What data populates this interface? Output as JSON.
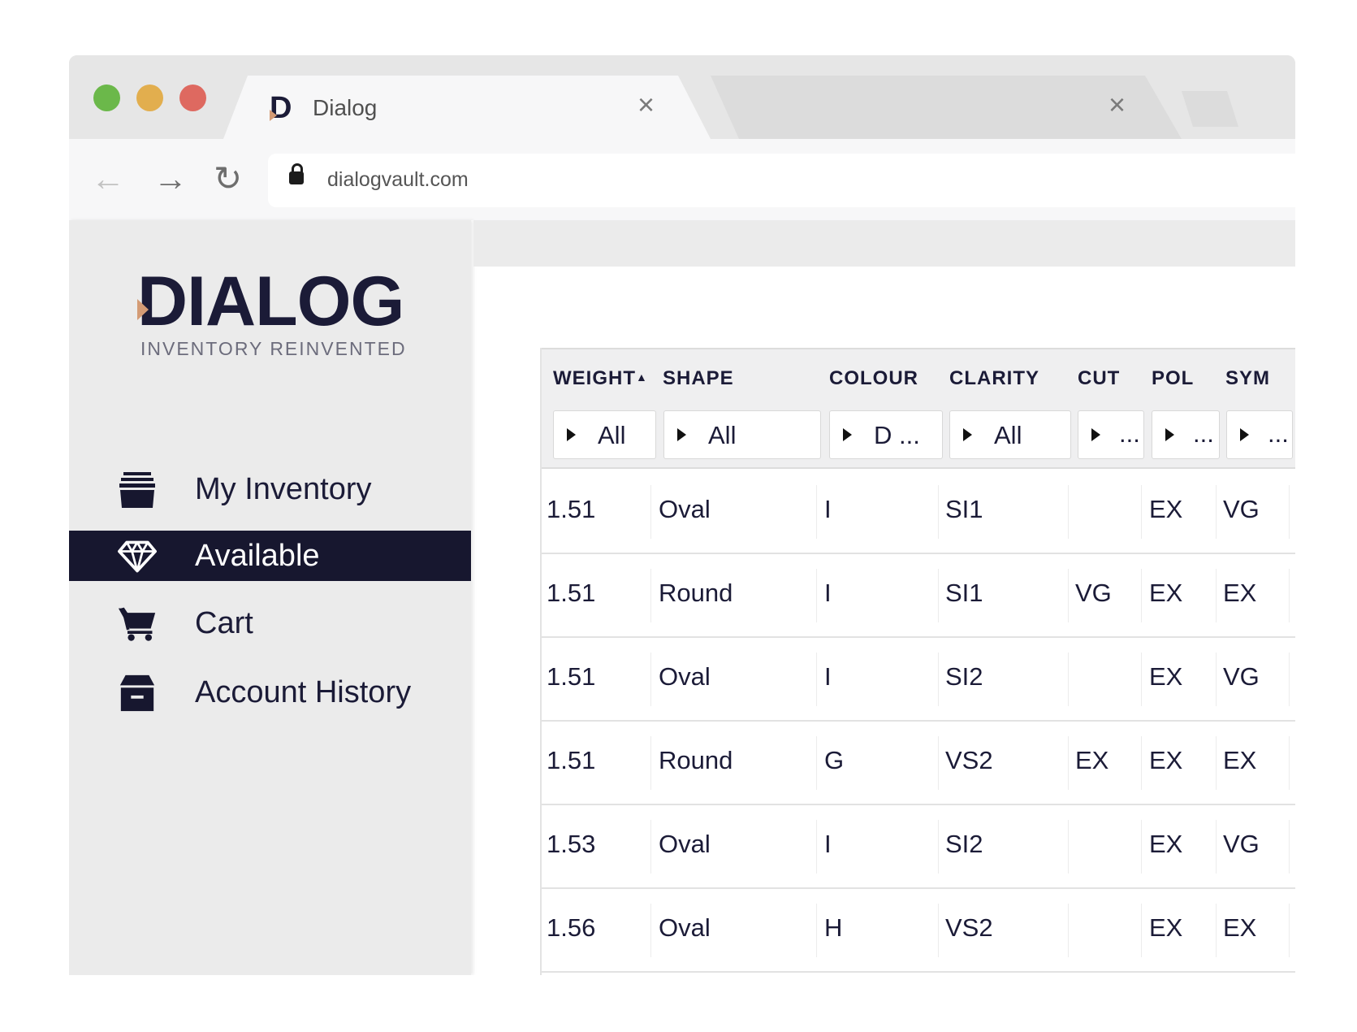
{
  "browser": {
    "tab_title": "Dialog",
    "tab_close": "×",
    "second_tab_close": "×",
    "url": "dialogvault.com",
    "nav": {
      "back": "←",
      "forward": "→",
      "reload": "↻"
    }
  },
  "sidebar": {
    "logo": {
      "word": "DIALOG",
      "tagline": "INVENTORY REINVENTED"
    },
    "items": [
      {
        "label": "My Inventory",
        "icon": "inventory-stack-icon",
        "active": false
      },
      {
        "label": "Available",
        "icon": "diamond-icon",
        "active": true
      },
      {
        "label": "Cart",
        "icon": "cart-icon",
        "active": false
      },
      {
        "label": "Account History",
        "icon": "archive-box-icon",
        "active": false
      }
    ]
  },
  "table": {
    "columns": [
      {
        "key": "weight",
        "label": "WEIGHT",
        "sort": "▲"
      },
      {
        "key": "shape",
        "label": "SHAPE"
      },
      {
        "key": "colour",
        "label": "COLOUR"
      },
      {
        "key": "clarity",
        "label": "CLARITY"
      },
      {
        "key": "cut",
        "label": "CUT"
      },
      {
        "key": "pol",
        "label": "POL"
      },
      {
        "key": "sym",
        "label": "SYM"
      }
    ],
    "filters": [
      "All",
      "All",
      "D ...",
      "All",
      "...",
      "...",
      "..."
    ],
    "rows": [
      [
        "1.51",
        "Oval",
        "I",
        "SI1",
        "",
        "EX",
        "VG"
      ],
      [
        "1.51",
        "Round",
        "I",
        "SI1",
        "VG",
        "EX",
        "EX"
      ],
      [
        "1.51",
        "Oval",
        "I",
        "SI2",
        "",
        "EX",
        "VG"
      ],
      [
        "1.51",
        "Round",
        "G",
        "VS2",
        "EX",
        "EX",
        "EX"
      ],
      [
        "1.53",
        "Oval",
        "I",
        "SI2",
        "",
        "EX",
        "VG"
      ],
      [
        "1.56",
        "Oval",
        "H",
        "VS2",
        "",
        "EX",
        "EX"
      ]
    ]
  },
  "colors": {
    "brand_navy": "#17172f",
    "brand_accent": "#d49b75",
    "traffic_green": "#6bb84a",
    "traffic_yellow": "#e2ae4e",
    "traffic_red": "#de6960"
  }
}
